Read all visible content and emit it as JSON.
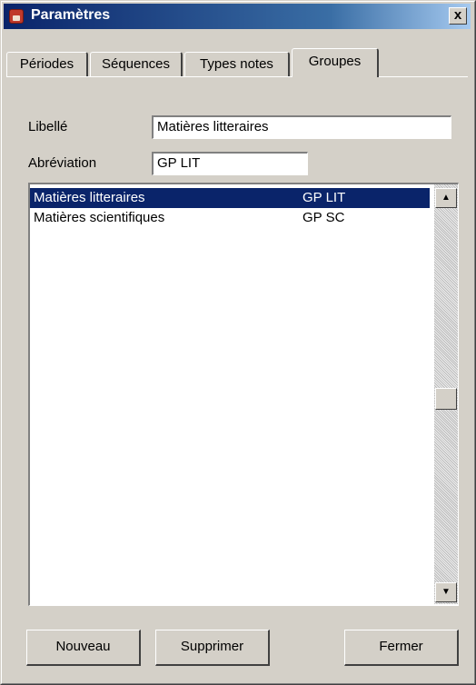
{
  "window": {
    "title": "Paramètres",
    "close_label": "x"
  },
  "tabs": [
    {
      "label": "Périodes"
    },
    {
      "label": "Séquences"
    },
    {
      "label": "Types notes"
    },
    {
      "label": "Groupes",
      "active": true
    }
  ],
  "form": {
    "libelle_label": "Libellé",
    "libelle_value": "Matières litteraires",
    "abreviation_label": "Abréviation",
    "abreviation_value": "GP LIT"
  },
  "list": {
    "rows": [
      {
        "name": "Matières litteraires",
        "abbr": "GP LIT",
        "selected": true
      },
      {
        "name": "Matières scientifiques",
        "abbr": "GP SC",
        "selected": false
      }
    ]
  },
  "buttons": {
    "new_label": "Nouveau",
    "delete_label": "Supprimer",
    "close_label": "Fermer"
  },
  "colors": {
    "selection": "#0a246a",
    "titlebar": "#0a246a",
    "window_bg": "#d4d0c8"
  }
}
